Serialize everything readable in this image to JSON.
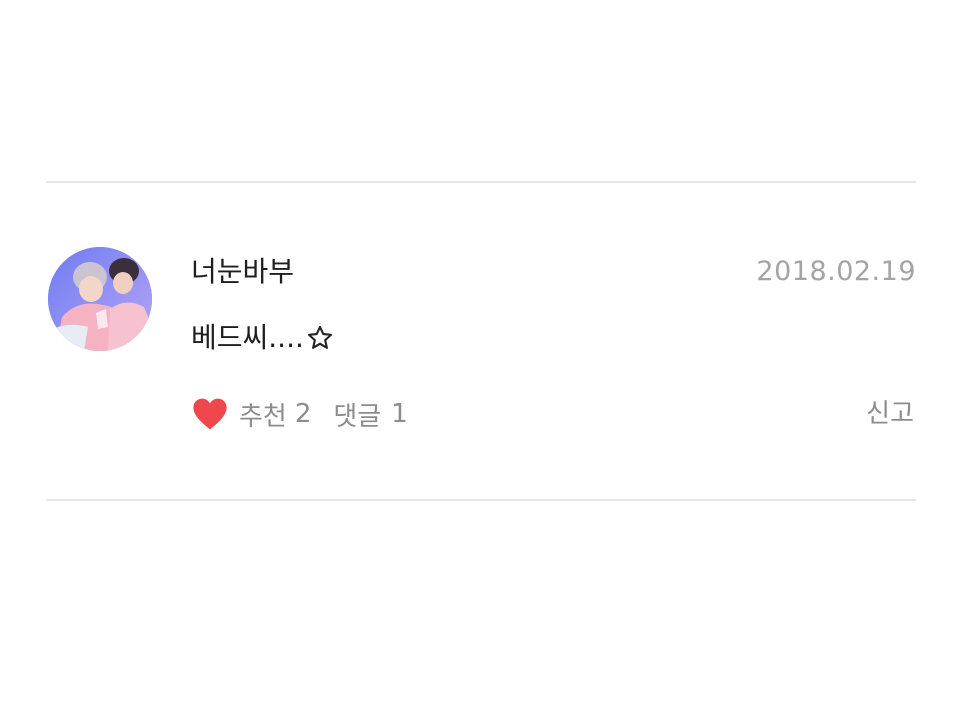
{
  "comment": {
    "author": "너눈바부",
    "date": "2018.02.19",
    "text": "베드씨....",
    "text_icon": "star-outline-icon",
    "like_icon": "heart-icon",
    "like_label": "추천",
    "like_count": "2",
    "reply_label": "댓글",
    "reply_count": "1",
    "report_label": "신고"
  },
  "colors": {
    "heart": "#f0474f",
    "muted_text": "#8c8c8c",
    "date_text": "#a4a4a4",
    "divider": "#e6e6e6"
  }
}
